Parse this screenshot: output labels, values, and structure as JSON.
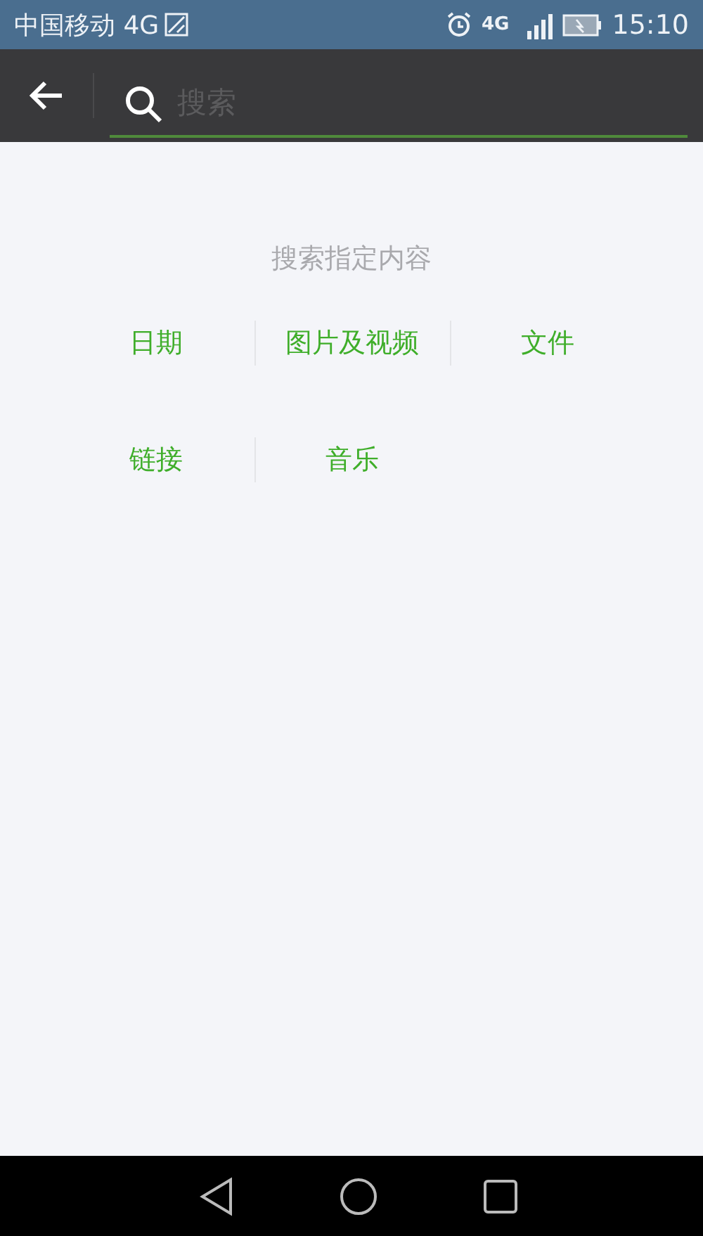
{
  "status_bar": {
    "carrier": "中国移动 4G",
    "network": "4G",
    "time": "15:10"
  },
  "search_bar": {
    "placeholder": "搜索"
  },
  "search_hint": "搜索指定内容",
  "categories": [
    {
      "label": "日期"
    },
    {
      "label": "图片及视频"
    },
    {
      "label": "文件"
    },
    {
      "label": "链接"
    },
    {
      "label": "音乐"
    }
  ]
}
